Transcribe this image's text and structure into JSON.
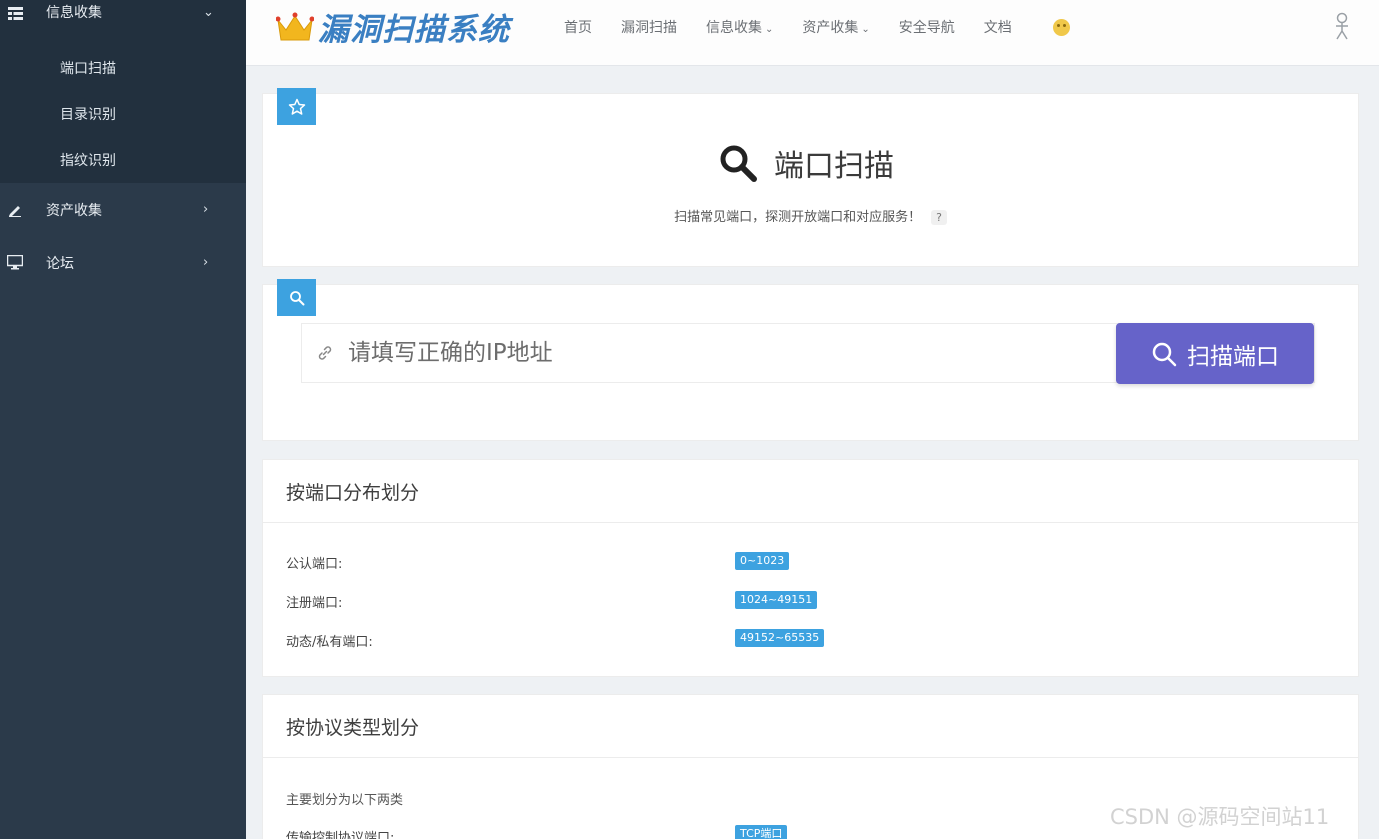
{
  "sidebar": {
    "group_open": {
      "label": "信息收集",
      "icon": "table-icon",
      "arrow": "⌄"
    },
    "sub_items": [
      {
        "label": "端口扫描"
      },
      {
        "label": "目录识别"
      },
      {
        "label": "指纹识别"
      }
    ],
    "groups": [
      {
        "label": "资产收集",
        "icon": "pencil-icon",
        "arrow": "›"
      },
      {
        "label": "论坛",
        "icon": "monitor-icon",
        "arrow": "›"
      }
    ]
  },
  "header": {
    "logo_text": "漏洞扫描系统",
    "nav": [
      {
        "label": "首页"
      },
      {
        "label": "漏洞扫描"
      },
      {
        "label": "信息收集",
        "dropdown": true
      },
      {
        "label": "资产收集",
        "dropdown": true
      },
      {
        "label": "安全导航"
      },
      {
        "label": "文档"
      }
    ],
    "caret": "⌄"
  },
  "hero": {
    "title": "端口扫描",
    "subtitle": "扫描常见端口，探测开放端口和对应服务！",
    "help": "?"
  },
  "scan": {
    "placeholder": "请填写正确的IP地址",
    "button_label": "扫描端口"
  },
  "port_section": {
    "title": "按端口分布划分",
    "rows": [
      {
        "label": "公认端口:",
        "tag": "0~1023"
      },
      {
        "label": "注册端口:",
        "tag": "1024~49151"
      },
      {
        "label": "动态/私有端口:",
        "tag": "49152~65535"
      }
    ]
  },
  "protocol_section": {
    "title": "按协议类型划分",
    "note": "主要划分为以下两类",
    "rows": [
      {
        "label": "传输控制协议端口:",
        "tag": "TCP端口"
      }
    ]
  },
  "watermark": "CSDN @源码空间站11",
  "colors": {
    "accent": "#3da2e0",
    "button": "#6663c9",
    "sidebar": "#2b3a4a",
    "logo": "#3a7fc2"
  }
}
